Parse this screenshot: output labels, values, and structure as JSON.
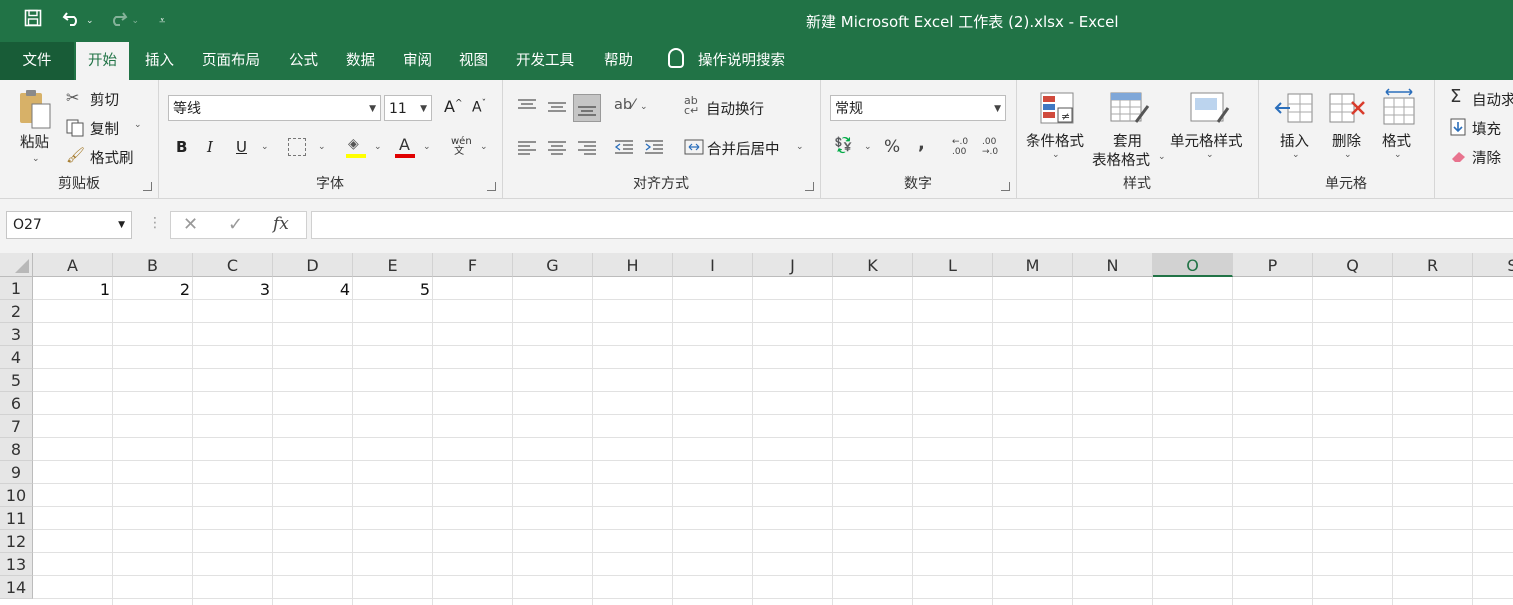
{
  "window": {
    "title": "新建 Microsoft Excel 工作表 (2).xlsx  -  Excel"
  },
  "quick_access": [
    "save-icon",
    "undo-icon",
    "redo-icon",
    "customize-icon"
  ],
  "tabs": [
    {
      "label": "文件",
      "x": 0
    },
    {
      "label": "开始",
      "active": true
    },
    {
      "label": "插入"
    },
    {
      "label": "页面布局"
    },
    {
      "label": "公式"
    },
    {
      "label": "数据"
    },
    {
      "label": "审阅"
    },
    {
      "label": "视图"
    },
    {
      "label": "开发工具"
    },
    {
      "label": "帮助"
    }
  ],
  "tell_me": "操作说明搜索",
  "ribbon": {
    "clipboard": {
      "paste": "粘贴",
      "cut": "剪切",
      "copy": "复制",
      "format_painter": "格式刷",
      "label": "剪贴板"
    },
    "font": {
      "name": "等线",
      "size": "11",
      "bold": "B",
      "italic": "I",
      "underline": "U",
      "label": "字体"
    },
    "alignment": {
      "wrap": "自动换行",
      "merge": "合并后居中",
      "label": "对齐方式"
    },
    "number": {
      "format": "常规",
      "percent": "%",
      "comma": ",",
      "label": "数字"
    },
    "styles": {
      "conditional": "条件格式",
      "table_line1": "套用",
      "table_line2": "表格格式",
      "cell_styles": "单元格样式",
      "label": "样式"
    },
    "cells": {
      "insert": "插入",
      "delete": "删除",
      "format": "格式",
      "label": "单元格"
    },
    "editing": {
      "autosum": "自动求和",
      "fill": "填充",
      "clear": "清除"
    }
  },
  "formula_bar": {
    "name_box": "O27",
    "cancel": "✕",
    "enter": "✓",
    "fx": "fx",
    "value": ""
  },
  "sheet": {
    "columns": [
      "A",
      "B",
      "C",
      "D",
      "E",
      "F",
      "G",
      "H",
      "I",
      "J",
      "K",
      "L",
      "M",
      "N",
      "O",
      "P",
      "Q",
      "R",
      "S"
    ],
    "selected_column": "O",
    "rows": [
      "1",
      "2",
      "3",
      "4",
      "5",
      "6",
      "7",
      "8",
      "9",
      "10",
      "11",
      "12",
      "13",
      "14"
    ],
    "cells": [
      {
        "ref": "A1",
        "value": "1"
      },
      {
        "ref": "B1",
        "value": "2"
      },
      {
        "ref": "C1",
        "value": "3"
      },
      {
        "ref": "D1",
        "value": "4"
      },
      {
        "ref": "E1",
        "value": "5"
      }
    ]
  },
  "colors": {
    "accent": "#217346",
    "ribbon_bg": "#f3f3f3",
    "gridline": "#e1e1e1"
  }
}
